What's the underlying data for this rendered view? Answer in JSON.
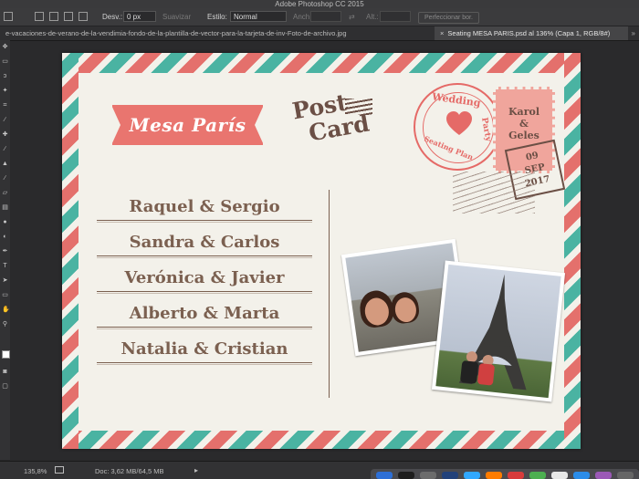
{
  "app": {
    "title": "Adobe Photoshop CC 2015"
  },
  "options_bar": {
    "feather_label": "Desv.:",
    "feather_value": "0 px",
    "smooth_label": "Suavizar",
    "style_label": "Estilo:",
    "style_value": "Normal",
    "width_label": "Anch.:",
    "height_label": "Alt.:",
    "refine_button": "Perfeccionar bor."
  },
  "tabs": [
    {
      "label": "e-vacaciones-de-verano-de-la-vendimia-fondo-de-la-plantilla-de-vector-para-la-tarjeta-de-inv-Foto-de-archivo.jpg"
    },
    {
      "label": "Seating MESA PARIS.psd al 136% (Capa 1, RGB/8#)",
      "close": "×"
    }
  ],
  "tabs_more": "»",
  "postcard": {
    "banner": "Mesa París",
    "logo_line1": "Post",
    "logo_line2": "Card",
    "names": [
      "Raquel & Sergio",
      "Sandra & Carlos",
      "Verónica & Javier",
      "Alberto & Marta",
      "Natalia & Cristian"
    ],
    "stamp_text": "Karol\n&\nGeles",
    "postmark_top": "Wedding",
    "postmark_right": "Party",
    "postmark_bottom": "Seating Plan",
    "date_day": "09",
    "date_month": "SEP",
    "date_year": "2017"
  },
  "status": {
    "zoom": "135,8%",
    "doc": "Doc: 3,62 MB/64,5 MB",
    "play": "▸"
  },
  "colors": {
    "teal": "#4ab3a2",
    "coral": "#e4706c",
    "brown": "#6b4f45",
    "paper": "#f3f1ea"
  }
}
